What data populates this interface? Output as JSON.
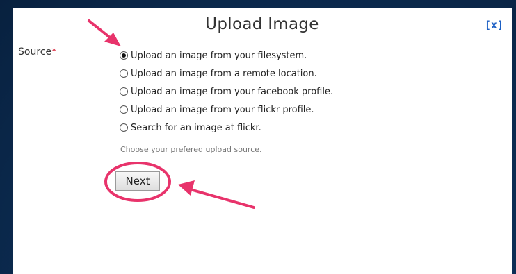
{
  "dialog": {
    "title": "Upload Image",
    "close_label": "[x]"
  },
  "form": {
    "source_label": "Source",
    "required_mark": "*",
    "options": [
      {
        "label": "Upload an image from your filesystem.",
        "checked": true
      },
      {
        "label": "Upload an image from a remote location.",
        "checked": false
      },
      {
        "label": "Upload an image from your facebook profile.",
        "checked": false
      },
      {
        "label": "Upload an image from your flickr profile.",
        "checked": false
      },
      {
        "label": "Search for an image at flickr.",
        "checked": false
      }
    ],
    "hint": "Choose your prefered upload source.",
    "next_label": "Next"
  },
  "colors": {
    "annotation": "#e8336b",
    "link": "#1c5fc4",
    "required": "#d0021b"
  }
}
